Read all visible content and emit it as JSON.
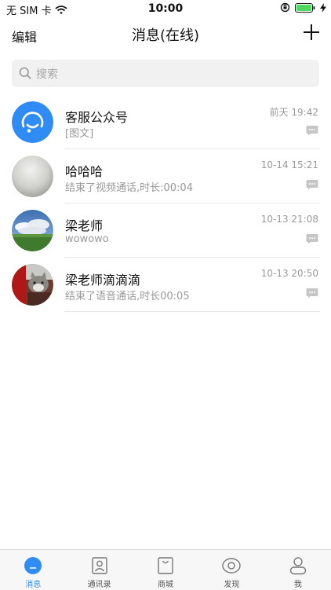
{
  "status_bar": {
    "carrier": "无 SIM 卡",
    "time": "10:00"
  },
  "nav": {
    "edit_label": "编辑",
    "title": "消息(在线)"
  },
  "search": {
    "placeholder": "搜索"
  },
  "conversations": [
    {
      "name": "客服公众号",
      "preview": "[图文]",
      "time": "前天 19:42",
      "avatar": "service-agent-icon"
    },
    {
      "name": "哈哈哈",
      "preview": "结束了视频通话,时长:00:04",
      "time": "10-14 15:21",
      "avatar": "grey-ball-photo"
    },
    {
      "name": "梁老师",
      "preview": "wowowo",
      "time": "10-13 21:08",
      "avatar": "landscape-photo"
    },
    {
      "name": "梁老师滴滴滴",
      "preview": "结束了语音通话,时长00:05",
      "time": "10-13 20:50",
      "avatar": "cat-photo"
    }
  ],
  "tabs": [
    {
      "label": "消息",
      "icon": "message-icon",
      "active": true
    },
    {
      "label": "通讯录",
      "icon": "contacts-icon"
    },
    {
      "label": "商城",
      "icon": "shop-icon"
    },
    {
      "label": "发现",
      "icon": "discover-icon"
    },
    {
      "label": "我",
      "icon": "profile-icon"
    }
  ],
  "colors": {
    "accent": "#2f8cf5",
    "battery": "#4cd964"
  }
}
